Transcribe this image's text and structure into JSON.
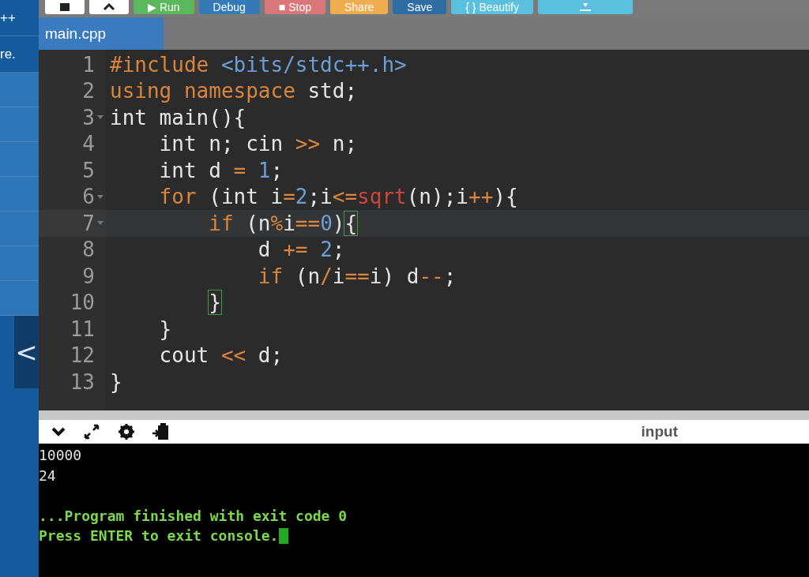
{
  "sidebar": {
    "items": [
      {
        "label": "++",
        "kind": "text"
      },
      {
        "label": "re.",
        "kind": "text"
      },
      {
        "kind": "blank"
      },
      {
        "kind": "blank"
      },
      {
        "kind": "blank"
      },
      {
        "kind": "blank"
      },
      {
        "kind": "blank"
      },
      {
        "kind": "blank"
      },
      {
        "kind": "blank"
      }
    ],
    "collapse_label": "<"
  },
  "toolbar": {
    "buttons": [
      {
        "kind": "square"
      },
      {
        "kind": "arrows"
      },
      {
        "kind": "run",
        "label": "▶ Run"
      },
      {
        "kind": "debug",
        "label": "Debug"
      },
      {
        "kind": "stop",
        "label": "■ Stop"
      },
      {
        "kind": "share",
        "label": "Share"
      },
      {
        "kind": "save",
        "label": "Save"
      },
      {
        "kind": "beautify",
        "label": "{ } Beautify"
      },
      {
        "kind": "download"
      }
    ]
  },
  "tabs": [
    {
      "label": "main.cpp",
      "selected": true
    }
  ],
  "editor": {
    "lines": [
      {
        "number": "1",
        "fold": false,
        "active": false,
        "tokens": [
          {
            "kind": "keyword",
            "text": "#include "
          },
          {
            "kind": "string",
            "text": "<bits/stdc++.h>"
          }
        ]
      },
      {
        "number": "2",
        "fold": false,
        "active": false,
        "tokens": [
          {
            "kind": "keyword",
            "text": "using namespace"
          },
          {
            "kind": "plain",
            "text": " std;"
          }
        ]
      },
      {
        "number": "3",
        "fold": true,
        "active": false,
        "tokens": [
          {
            "kind": "plain",
            "text": "int main(){"
          }
        ]
      },
      {
        "number": "4",
        "fold": false,
        "active": false,
        "tokens": [
          {
            "kind": "plain",
            "text": "    int n; cin "
          },
          {
            "kind": "operator",
            "text": ">>"
          },
          {
            "kind": "plain",
            "text": " n;"
          }
        ]
      },
      {
        "number": "5",
        "fold": false,
        "active": false,
        "tokens": [
          {
            "kind": "plain",
            "text": "    int d "
          },
          {
            "kind": "operator",
            "text": "= "
          },
          {
            "kind": "number",
            "text": "1"
          },
          {
            "kind": "plain",
            "text": ";"
          }
        ]
      },
      {
        "number": "6",
        "fold": true,
        "active": false,
        "tokens": [
          {
            "kind": "keyword",
            "text": "    for"
          },
          {
            "kind": "plain",
            "text": " (int i"
          },
          {
            "kind": "operator",
            "text": "="
          },
          {
            "kind": "number",
            "text": "2"
          },
          {
            "kind": "plain",
            "text": ";i"
          },
          {
            "kind": "operator",
            "text": "<="
          },
          {
            "kind": "function",
            "text": "sqrt"
          },
          {
            "kind": "plain",
            "text": "(n);i"
          },
          {
            "kind": "operator",
            "text": "++"
          },
          {
            "kind": "plain",
            "text": "){"
          }
        ]
      },
      {
        "number": "7",
        "fold": true,
        "active": true,
        "tokens": [
          {
            "kind": "keyword",
            "text": "        if"
          },
          {
            "kind": "plain",
            "text": " (n"
          },
          {
            "kind": "operator",
            "text": "%"
          },
          {
            "kind": "plain",
            "text": "i"
          },
          {
            "kind": "operator",
            "text": "=="
          },
          {
            "kind": "number",
            "text": "0"
          },
          {
            "kind": "plain",
            "text": ")"
          },
          {
            "kind": "match",
            "text": "{"
          }
        ]
      },
      {
        "number": "8",
        "fold": false,
        "active": false,
        "tokens": [
          {
            "kind": "plain",
            "text": "            d "
          },
          {
            "kind": "operator",
            "text": "+= "
          },
          {
            "kind": "number",
            "text": "2"
          },
          {
            "kind": "plain",
            "text": ";"
          }
        ]
      },
      {
        "number": "9",
        "fold": false,
        "active": false,
        "tokens": [
          {
            "kind": "keyword",
            "text": "            if"
          },
          {
            "kind": "plain",
            "text": " (n"
          },
          {
            "kind": "operator",
            "text": "/"
          },
          {
            "kind": "plain",
            "text": "i"
          },
          {
            "kind": "operator",
            "text": "=="
          },
          {
            "kind": "plain",
            "text": "i) d"
          },
          {
            "kind": "operator",
            "text": "--"
          },
          {
            "kind": "plain",
            "text": ";"
          }
        ]
      },
      {
        "number": "10",
        "fold": false,
        "active": false,
        "tokens": [
          {
            "kind": "match",
            "text": "        }"
          }
        ]
      },
      {
        "number": "11",
        "fold": false,
        "active": false,
        "tokens": [
          {
            "kind": "plain",
            "text": "    }"
          }
        ]
      },
      {
        "number": "12",
        "fold": false,
        "active": false,
        "tokens": [
          {
            "kind": "plain",
            "text": "    cout "
          },
          {
            "kind": "operator",
            "text": "<<"
          },
          {
            "kind": "plain",
            "text": " d;"
          }
        ]
      },
      {
        "number": "13",
        "fold": false,
        "active": false,
        "tokens": [
          {
            "kind": "plain",
            "text": "}"
          }
        ]
      }
    ]
  },
  "console": {
    "toolbar_label": "input",
    "lines": [
      {
        "kind": "output",
        "text": "10000"
      },
      {
        "kind": "output",
        "text": "24"
      },
      {
        "kind": "blank"
      },
      {
        "kind": "status",
        "text": "...Program finished with exit code 0"
      },
      {
        "kind": "status",
        "text": "Press ENTER to exit console.",
        "cursor": true
      }
    ]
  }
}
